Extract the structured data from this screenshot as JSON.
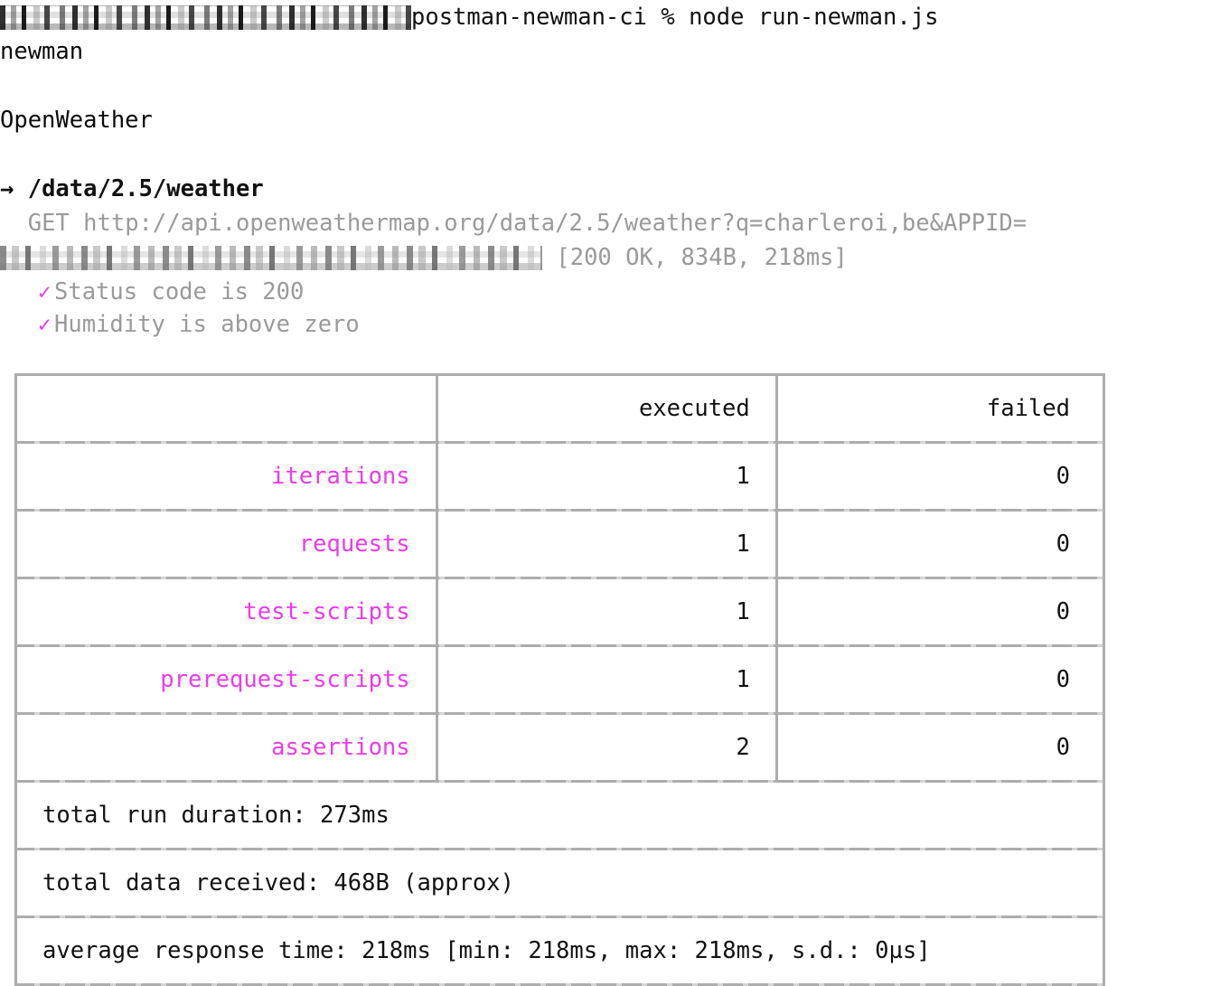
{
  "terminal": {
    "prompt_redacted_label": "redacted-user-host-path",
    "prompt_path": "postman-newman-ci",
    "prompt_symbol": "%",
    "command": "node run-newman.js",
    "runner_name": "newman",
    "collection_name": "OpenWeather"
  },
  "request": {
    "arrow_glyph": "→",
    "endpoint": "/data/2.5/weather",
    "method": "GET",
    "url": "http://api.openweathermap.org/data/2.5/weather?q=charleroi,be&APPID=",
    "apikey_redacted_label": "redacted-api-key",
    "response_meta": "[200 OK, 834B, 218ms]",
    "status_code": "200 OK",
    "size": "834B",
    "time": "218ms"
  },
  "assertions": [
    {
      "icon": "check-icon",
      "label": "Status code is 200",
      "passed": true
    },
    {
      "icon": "check-icon",
      "label": "Humidity is above zero",
      "passed": true
    }
  ],
  "summary_table": {
    "headers": [
      "",
      "executed",
      "failed"
    ],
    "rows": [
      {
        "metric": "iterations",
        "executed": "1",
        "failed": "0"
      },
      {
        "metric": "requests",
        "executed": "1",
        "failed": "0"
      },
      {
        "metric": "test-scripts",
        "executed": "1",
        "failed": "0"
      },
      {
        "metric": "prerequest-scripts",
        "executed": "1",
        "failed": "0"
      },
      {
        "metric": "assertions",
        "executed": "2",
        "failed": "0"
      }
    ],
    "footers": [
      "total run duration: 273ms",
      "total data received: 468B (approx)",
      "average response time: 218ms [min: 218ms, max: 218ms, s.d.: 0µs]"
    ]
  },
  "colors": {
    "accent_magenta": "#ea3ce8",
    "dim_gray": "#9a9a9a",
    "border_gray": "#adadad",
    "text_black": "#111111",
    "background": "#ffffff"
  }
}
